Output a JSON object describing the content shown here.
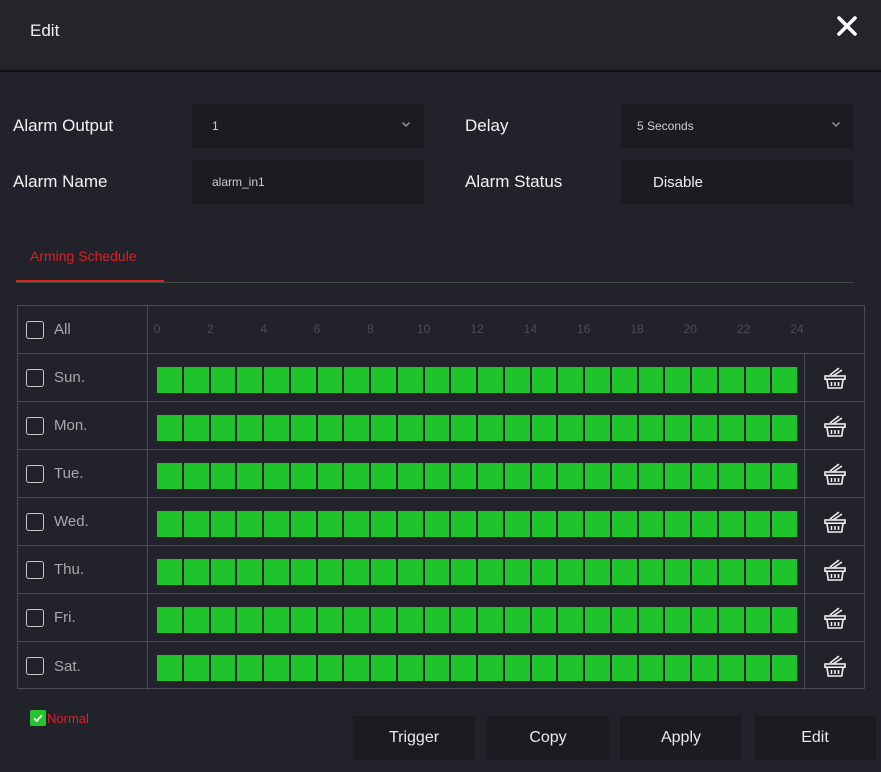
{
  "header": {
    "title": "Edit",
    "close_icon": "close-icon"
  },
  "form": {
    "alarm_output_label": "Alarm Output",
    "alarm_output_value": "1",
    "delay_label": "Delay",
    "delay_value": "5 Seconds",
    "alarm_name_label": "Alarm Name",
    "alarm_name_value": "alarm_in1",
    "alarm_status_label": "Alarm Status",
    "alarm_status_value": "Disable"
  },
  "tabs": [
    {
      "label": "Arming Schedule",
      "active": true
    }
  ],
  "schedule": {
    "all_label": "All",
    "hour_labels": [
      "0",
      "2",
      "4",
      "6",
      "8",
      "10",
      "12",
      "14",
      "16",
      "18",
      "20",
      "22",
      "24"
    ],
    "days": [
      "Sun.",
      "Mon.",
      "Tue.",
      "Wed.",
      "Thu.",
      "Fri.",
      "Sat."
    ],
    "segments_per_day": 24,
    "armed_color": "#1fc42c",
    "row_icon": "basket-icon"
  },
  "legend": {
    "label": "Normal",
    "color": "#24c52f"
  },
  "buttons": {
    "trigger": "Trigger",
    "copy": "Copy",
    "apply": "Apply",
    "edit": "Edit"
  },
  "colors": {
    "background": "#22232a",
    "accent": "#d8202a",
    "field_bg": "#1b1c20"
  }
}
